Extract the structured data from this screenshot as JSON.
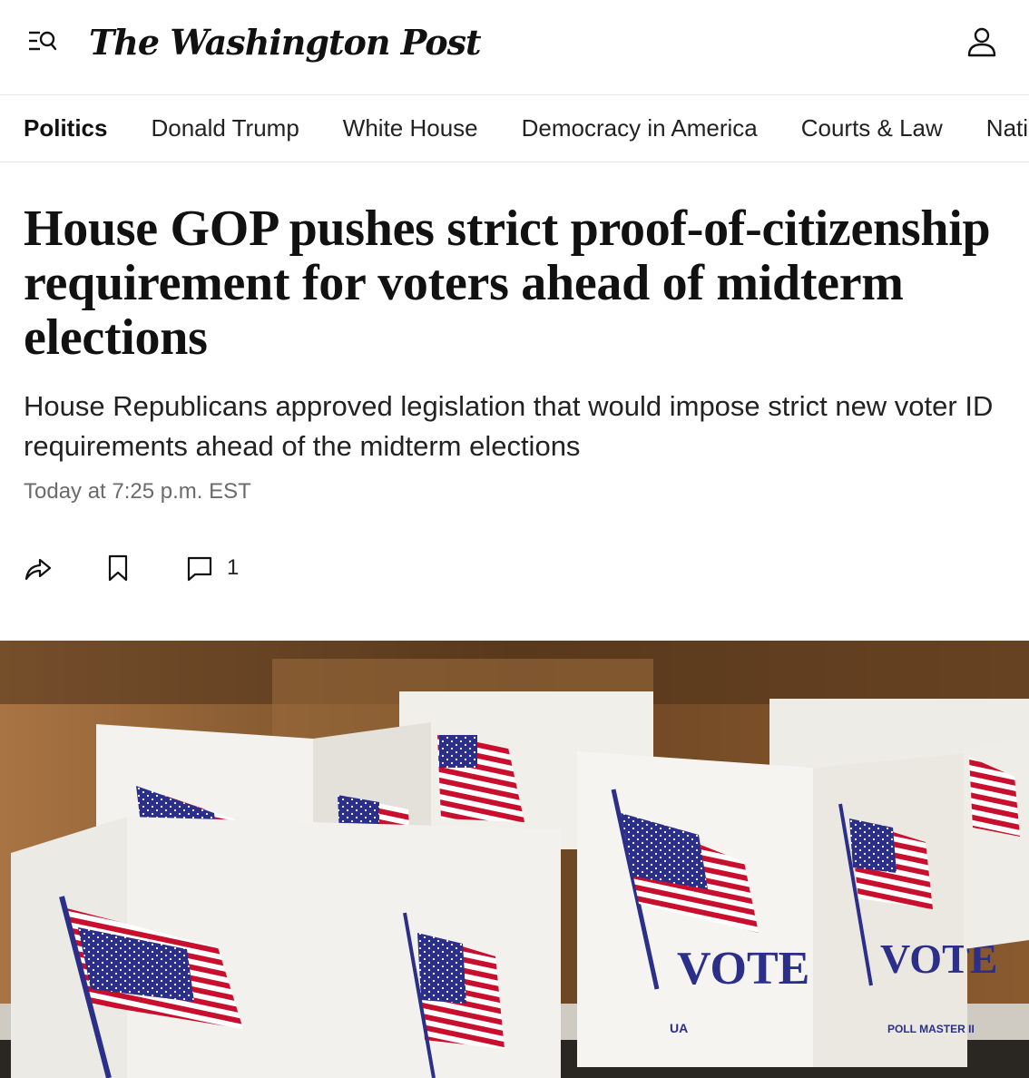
{
  "header": {
    "logo_text": "The Washington Post",
    "icons": {
      "menu": "menu-search-icon",
      "account": "user-icon"
    }
  },
  "nav": {
    "items": [
      {
        "label": "Politics",
        "active": true
      },
      {
        "label": "Donald Trump"
      },
      {
        "label": "White House"
      },
      {
        "label": "Democracy in America"
      },
      {
        "label": "Courts & Law"
      },
      {
        "label": "Nati"
      }
    ]
  },
  "article": {
    "headline": "House GOP pushes strict proof-of-citizenship requirement for voters ahead of midterm elections",
    "dek": "House Republicans approved legislation that would impose strict new voter ID requirements ahead of the midterm elections",
    "timestamp": "Today at 7:25 p.m. EST",
    "comment_count": "1",
    "icons": {
      "share": "share-icon",
      "bookmark": "bookmark-icon",
      "comment": "comment-icon"
    }
  },
  "photo": {
    "booth_text": "VOTE",
    "brand_left": "UA",
    "brand_right": "POLL MASTER II"
  },
  "colors": {
    "text": "#111111",
    "muted": "#6b6b6b",
    "divider": "#e6e6e6",
    "flag_red": "#c8102e",
    "flag_blue": "#2b2f8a"
  }
}
